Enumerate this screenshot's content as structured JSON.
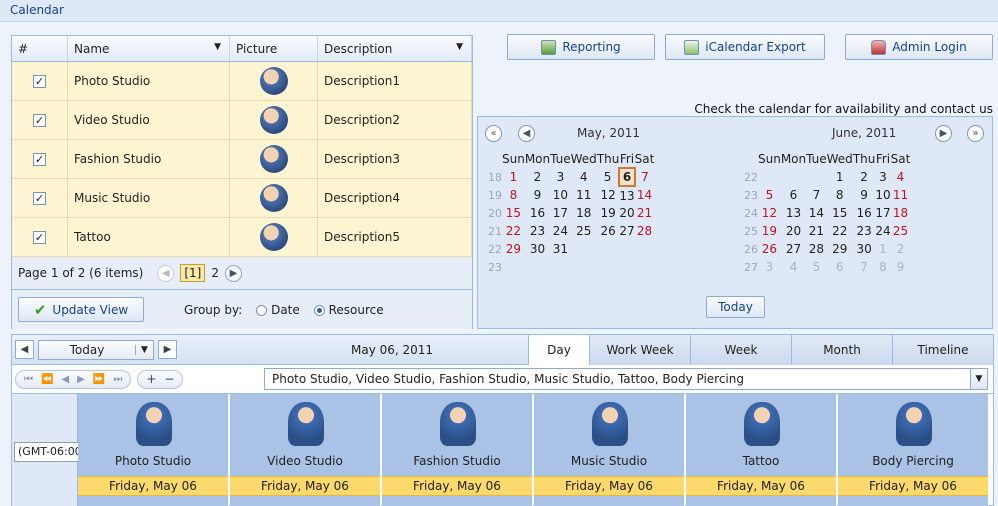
{
  "window": {
    "title": "Calendar"
  },
  "grid": {
    "headers": {
      "num": "#",
      "name": "Name",
      "picture": "Picture",
      "description": "Description"
    },
    "rows": [
      {
        "checked": true,
        "name": "Photo Studio",
        "icon": "photographer-icon",
        "description": "Description1"
      },
      {
        "checked": true,
        "name": "Video Studio",
        "icon": "videographer-icon",
        "description": "Description2"
      },
      {
        "checked": true,
        "name": "Fashion Studio",
        "icon": "shirt-icon",
        "description": "Description3"
      },
      {
        "checked": true,
        "name": "Music Studio",
        "icon": "mixer-icon",
        "description": "Description4"
      },
      {
        "checked": true,
        "name": "Tattoo",
        "icon": "person-icon",
        "description": "Description5"
      }
    ],
    "pager": {
      "info": "Page 1 of 2 (6 items)",
      "current": "[1]",
      "next_page": "2"
    },
    "update_label": "Update View",
    "group_by_label": "Group by:",
    "group_options": {
      "date": "Date",
      "resource": "Resource"
    },
    "group_selected": "Resource"
  },
  "toolbar": {
    "reporting": "Reporting",
    "icalendar": "iCalendar Export",
    "admin": "Admin Login"
  },
  "contact_text": "Check the calendar for availability and contact us",
  "calendar": {
    "weekdays": [
      "Sun",
      "Mon",
      "Tue",
      "Wed",
      "Thu",
      "Fri",
      "Sat"
    ],
    "months": [
      {
        "title": "May, 2011",
        "weeks": [
          {
            "wk": "18",
            "days": [
              "1",
              "2",
              "3",
              "4",
              "5",
              "6",
              "7"
            ]
          },
          {
            "wk": "19",
            "days": [
              "8",
              "9",
              "10",
              "11",
              "12",
              "13",
              "14"
            ]
          },
          {
            "wk": "20",
            "days": [
              "15",
              "16",
              "17",
              "18",
              "19",
              "20",
              "21"
            ]
          },
          {
            "wk": "21",
            "days": [
              "22",
              "23",
              "24",
              "25",
              "26",
              "27",
              "28"
            ]
          },
          {
            "wk": "22",
            "days": [
              "29",
              "30",
              "31",
              "",
              "",
              "",
              ""
            ]
          },
          {
            "wk": "23",
            "days": [
              "",
              "",
              "",
              "",
              "",
              "",
              ""
            ]
          }
        ],
        "selected_day": "6"
      },
      {
        "title": "June, 2011",
        "weeks": [
          {
            "wk": "22",
            "days": [
              "",
              "",
              "",
              "1",
              "2",
              "3",
              "4"
            ]
          },
          {
            "wk": "23",
            "days": [
              "5",
              "6",
              "7",
              "8",
              "9",
              "10",
              "11"
            ]
          },
          {
            "wk": "24",
            "days": [
              "12",
              "13",
              "14",
              "15",
              "16",
              "17",
              "18"
            ]
          },
          {
            "wk": "25",
            "days": [
              "19",
              "20",
              "21",
              "22",
              "23",
              "24",
              "25"
            ]
          },
          {
            "wk": "26",
            "days": [
              "26",
              "27",
              "28",
              "29",
              "30",
              "1",
              "2"
            ]
          },
          {
            "wk": "27",
            "days": [
              "3",
              "4",
              "5",
              "6",
              "7",
              "8",
              "9"
            ]
          }
        ],
        "other_month_from_index": 33
      }
    ],
    "today_label": "Today"
  },
  "scheduler": {
    "today_label": "Today",
    "date": "May 06, 2011",
    "views": [
      "Day",
      "Work Week",
      "Week",
      "Month",
      "Timeline"
    ],
    "active_view": "Day",
    "resource_filter": "Photo Studio, Video Studio, Fashion Studio, Music Studio, Tattoo, Body Piercing",
    "timezone": "(GMT-06:00)",
    "resources": [
      {
        "name": "Photo Studio",
        "date": "Friday, May 06",
        "icon": "photographer-icon"
      },
      {
        "name": "Video Studio",
        "date": "Friday, May 06",
        "icon": "videographer-icon"
      },
      {
        "name": "Fashion Studio",
        "date": "Friday, May 06",
        "icon": "shirt-icon"
      },
      {
        "name": "Music Studio",
        "date": "Friday, May 06",
        "icon": "mixer-icon"
      },
      {
        "name": "Tattoo",
        "date": "Friday, May 06",
        "icon": "person-icon"
      },
      {
        "name": "Body Piercing",
        "date": "Friday, May 06",
        "icon": "operator-icon"
      }
    ]
  },
  "colors": {
    "accent": "#99bbe8",
    "row_bg": "#fdf5d2",
    "weekend": "#c1121f",
    "date_header": "#fbd96c"
  }
}
